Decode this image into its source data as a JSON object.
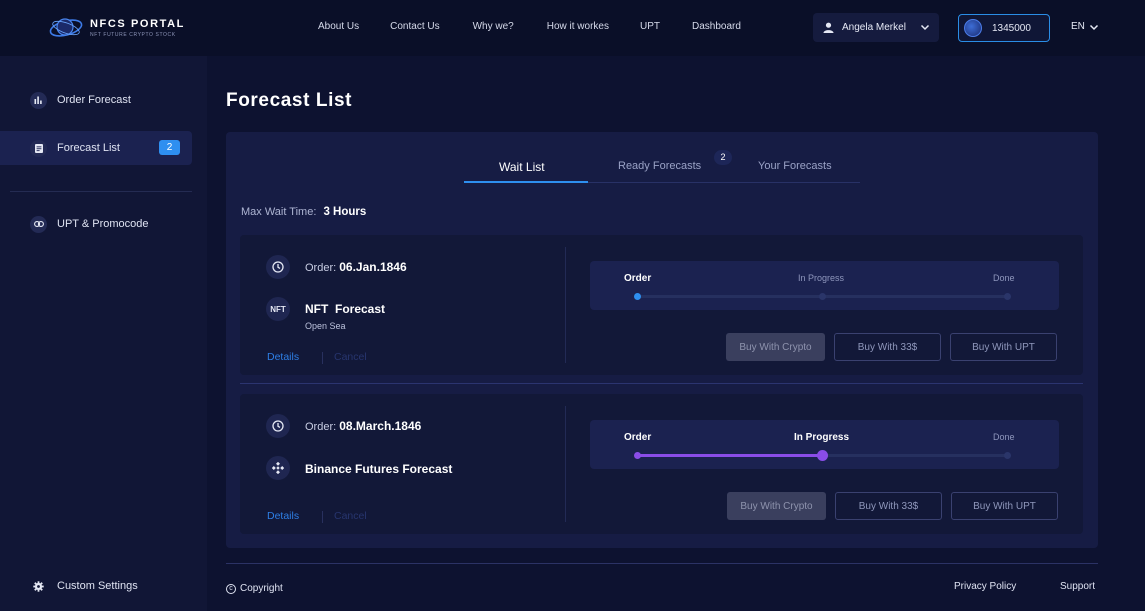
{
  "brand": {
    "title": "NFCS PORTAL",
    "subtitle": "NFT FUTURE CRYPTO STOCK"
  },
  "nav": [
    "About Us",
    "Contact Us",
    "Why we?",
    "How it workes",
    "UPT",
    "Dashboard"
  ],
  "user": {
    "name": "Angela Merkel"
  },
  "balance": "1345000",
  "language": "EN",
  "sidebar": {
    "items": [
      {
        "label": "Order Forecast",
        "icon": "bar-chart-icon"
      },
      {
        "label": "Forecast List",
        "icon": "list-icon",
        "badge": "2"
      },
      {
        "label": "UPT & Promocode",
        "icon": "link-icon"
      }
    ],
    "settings": "Custom Settings"
  },
  "page_title": "Forecast List",
  "tabs": [
    {
      "label": "Wait List"
    },
    {
      "label": "Ready Forecasts",
      "badge": "2"
    },
    {
      "label": "Your Forecasts"
    }
  ],
  "max_wait": {
    "label": "Max Wait Time:",
    "value": "3 Hours"
  },
  "cards": [
    {
      "order_label": "Order:",
      "order_date": "06.Jan.1846",
      "type_icon_text": "NFT",
      "title": "NFT  Forecast",
      "subtitle": "Open Sea",
      "details": "Details",
      "cancel": "Cancel",
      "steps": [
        "Order",
        "In Progress",
        "Done"
      ],
      "progress": 0
    },
    {
      "order_label": "Order:",
      "order_date": "08.March.1846",
      "type_icon_text": "",
      "title": "Binance Futures Forecast",
      "subtitle": "",
      "details": "Details",
      "cancel": "Cancel",
      "steps": [
        "Order",
        "In Progress",
        "Done"
      ],
      "progress": 0.5
    }
  ],
  "buttons": {
    "crypto": "Buy With Crypto",
    "usd": "Buy With 33$",
    "upt": "Buy With UPT"
  },
  "footer": {
    "copyright": "Copyright",
    "privacy": "Privacy Policy",
    "support": "Support"
  }
}
